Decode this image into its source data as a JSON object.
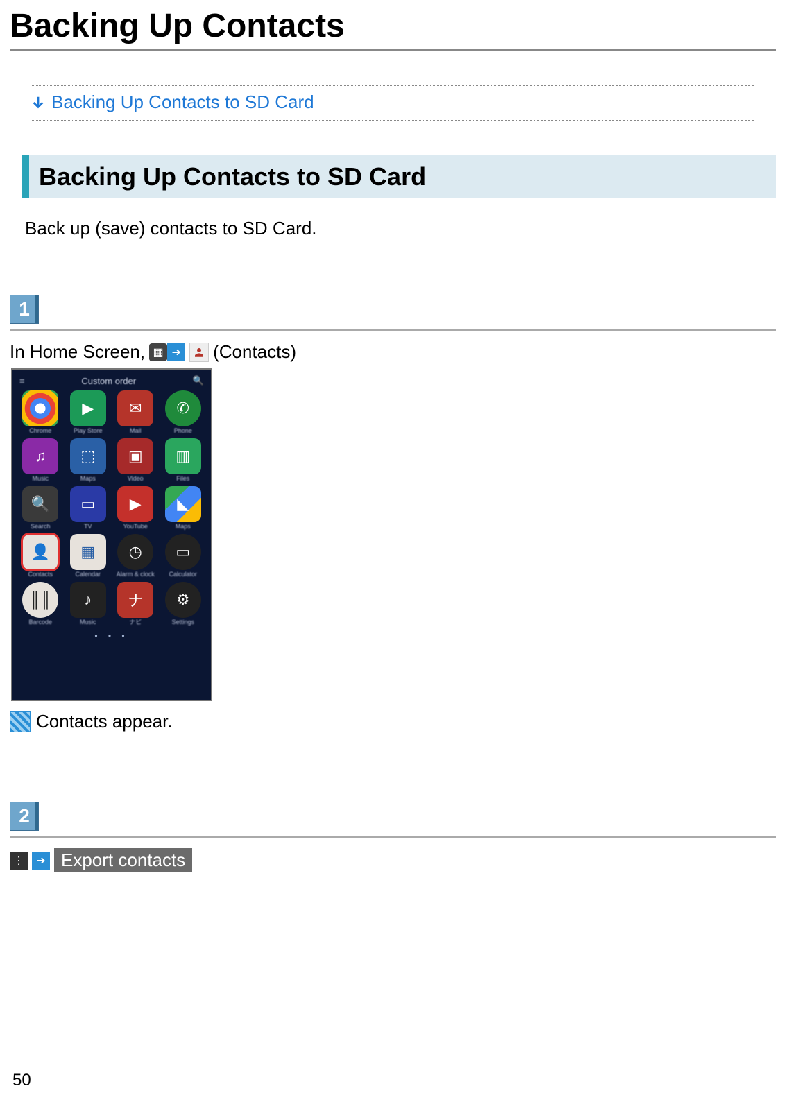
{
  "page": {
    "title": "Backing Up Contacts",
    "number": "50"
  },
  "toc": {
    "link_text": "Backing Up Contacts to SD Card"
  },
  "section": {
    "heading": "Backing Up Contacts to SD Card",
    "intro": "Back up (save) contacts to SD Card."
  },
  "steps": {
    "step1": {
      "badge": "1",
      "prefix": "In Home Screen,",
      "suffix": " (Contacts)",
      "result": "Contacts appear.",
      "phone": {
        "top_label": "Custom order",
        "search_glyph": "🔍",
        "menu_glyph": "≡",
        "dots": "•  •  •",
        "apps": [
          {
            "label": "Chrome",
            "glyph": "◐",
            "cls": "c-chrome"
          },
          {
            "label": "Play Store",
            "glyph": "▶",
            "cls": "c-play"
          },
          {
            "label": "Mail",
            "glyph": "✉",
            "cls": "c-mail"
          },
          {
            "label": "Phone",
            "glyph": "✆",
            "cls": "c-phone round"
          },
          {
            "label": "Music",
            "glyph": "♫",
            "cls": "c-music"
          },
          {
            "label": "Maps",
            "glyph": "⬚",
            "cls": "c-maps2"
          },
          {
            "label": "Video",
            "glyph": "▣",
            "cls": "c-video"
          },
          {
            "label": "Files",
            "glyph": "▥",
            "cls": "c-file"
          },
          {
            "label": "Search",
            "glyph": "🔍",
            "cls": "c-search"
          },
          {
            "label": "TV",
            "glyph": "▭",
            "cls": "c-tv"
          },
          {
            "label": "YouTube",
            "glyph": "▶",
            "cls": "c-yt"
          },
          {
            "label": "Maps",
            "glyph": "◣",
            "cls": "c-maps"
          },
          {
            "label": "Contacts",
            "glyph": "👤",
            "cls": "c-contacts",
            "highlight": true
          },
          {
            "label": "Calendar",
            "glyph": "▦",
            "cls": "c-cal"
          },
          {
            "label": "Alarm & clock",
            "glyph": "◷",
            "cls": "c-clock round"
          },
          {
            "label": "Calculator",
            "glyph": "▭",
            "cls": "c-calc round"
          },
          {
            "label": "Barcode",
            "glyph": "║║",
            "cls": "c-barcode round"
          },
          {
            "label": "Music",
            "glyph": "♪",
            "cls": "c-eq"
          },
          {
            "label": "ナビ",
            "glyph": "ナ",
            "cls": "c-jp"
          },
          {
            "label": "Settings",
            "glyph": "⚙",
            "cls": "c-settings round"
          }
        ]
      }
    },
    "step2": {
      "badge": "2",
      "menu_glyph": "⋮",
      "arrow_glyph": "➜",
      "action_label": "Export contacts"
    }
  }
}
